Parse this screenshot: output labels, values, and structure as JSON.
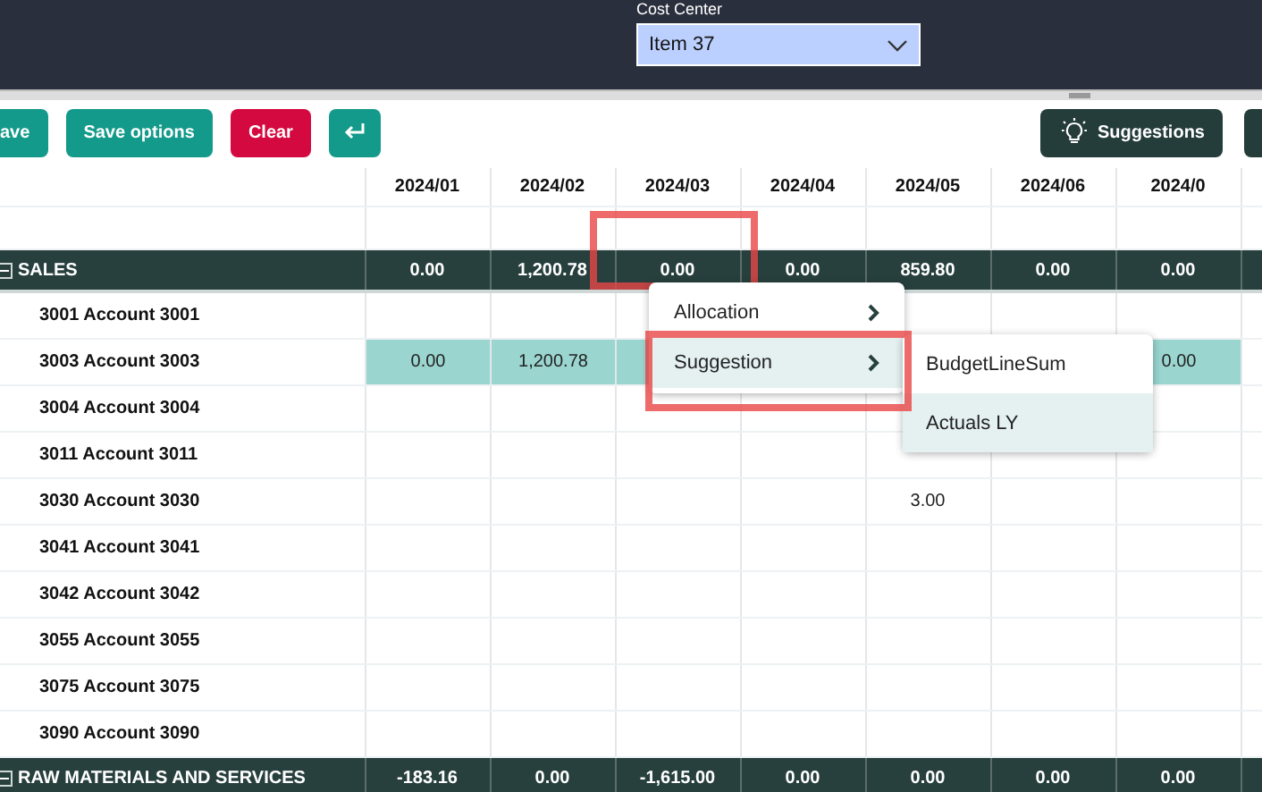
{
  "header": {
    "cost_center": {
      "label": "Cost Center",
      "value": "Item 37"
    }
  },
  "toolbar": {
    "left_buttons": [
      {
        "label": "ave",
        "kind": "primary"
      },
      {
        "label": "Save options",
        "kind": "primary"
      },
      {
        "label": "Clear",
        "kind": "danger"
      },
      {
        "kind": "enter"
      }
    ],
    "right_buttons": [
      {
        "label": "Suggestions",
        "kind": "suggest"
      },
      {
        "kind": "edge"
      }
    ]
  },
  "table": {
    "columns": [
      "2024/01",
      "2024/02",
      "2024/03",
      "2024/04",
      "2024/05",
      "2024/06",
      "2024/0"
    ],
    "rows": [
      {
        "kind": "spacer",
        "cells": [
          "",
          "",
          "",
          "",
          "",
          "",
          ""
        ]
      },
      {
        "kind": "group",
        "label": "SALES",
        "expanded": true,
        "cells": [
          "0.00",
          "1,200.78",
          "0.00",
          "0.00",
          "859.80",
          "0.00",
          "0.00"
        ]
      },
      {
        "kind": "account",
        "label": "3001 Account 3001",
        "highlighted": false,
        "cells": [
          "",
          "",
          "",
          "",
          "",
          "",
          ""
        ]
      },
      {
        "kind": "account",
        "label": "3003 Account 3003",
        "highlighted": true,
        "cells": [
          "0.00",
          "1,200.78",
          "",
          "",
          "",
          "",
          "0.00"
        ]
      },
      {
        "kind": "account",
        "label": "3004 Account 3004",
        "highlighted": false,
        "cells": [
          "",
          "",
          "",
          "",
          "",
          "",
          ""
        ]
      },
      {
        "kind": "account",
        "label": "3011 Account 3011",
        "highlighted": false,
        "cells": [
          "",
          "",
          "",
          "",
          "",
          "",
          ""
        ]
      },
      {
        "kind": "account",
        "label": "3030 Account 3030",
        "highlighted": false,
        "cells": [
          "",
          "",
          "",
          "",
          "3.00",
          "",
          ""
        ]
      },
      {
        "kind": "account",
        "label": "3041 Account 3041",
        "highlighted": false,
        "cells": [
          "",
          "",
          "",
          "",
          "",
          "",
          ""
        ]
      },
      {
        "kind": "account",
        "label": "3042 Account 3042",
        "highlighted": false,
        "cells": [
          "",
          "",
          "",
          "",
          "",
          "",
          ""
        ]
      },
      {
        "kind": "account",
        "label": "3055 Account 3055",
        "highlighted": false,
        "cells": [
          "",
          "",
          "",
          "",
          "",
          "",
          ""
        ]
      },
      {
        "kind": "account",
        "label": "3075 Account 3075",
        "highlighted": false,
        "cells": [
          "",
          "",
          "",
          "",
          "",
          "",
          ""
        ]
      },
      {
        "kind": "account",
        "label": "3090 Account 3090",
        "highlighted": false,
        "cells": [
          "",
          "",
          "",
          "",
          "",
          "",
          ""
        ]
      },
      {
        "kind": "group",
        "label": "RAW MATERIALS AND SERVICES",
        "expanded": true,
        "cells": [
          "-183.16",
          "0.00",
          "-1,615.00",
          "0.00",
          "0.00",
          "0.00",
          "0.00"
        ]
      }
    ]
  },
  "context_menu": {
    "items": [
      {
        "label": "Allocation",
        "selected": false
      },
      {
        "label": "Suggestion",
        "selected": true
      }
    ],
    "submenu": [
      {
        "label": "BudgetLineSum",
        "selected": false
      },
      {
        "label": "Actuals LY",
        "selected": true
      }
    ]
  }
}
